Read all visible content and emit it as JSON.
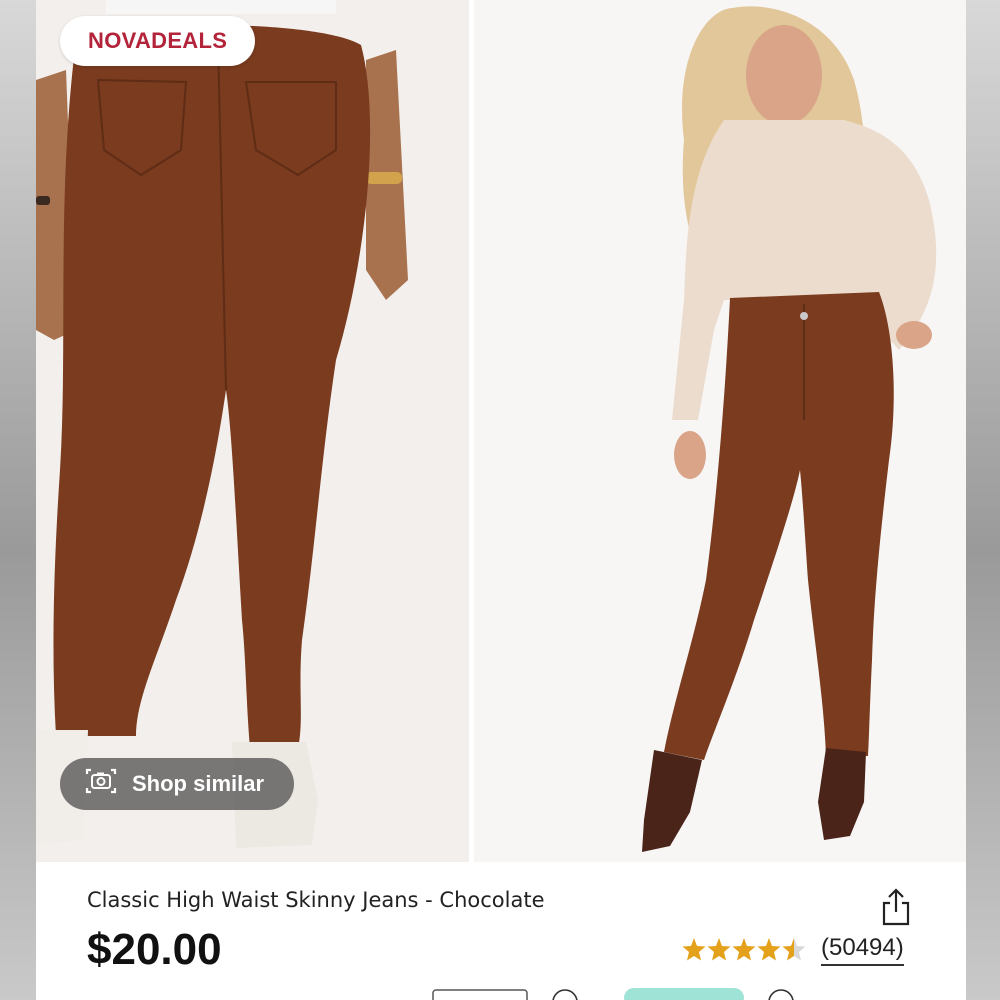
{
  "brand": {
    "label": "NOVADEALS"
  },
  "shop_similar": {
    "label": "Shop similar",
    "icon": "camera-icon"
  },
  "product": {
    "title": "Classic High Waist Skinny Jeans - Chocolate",
    "price": "$20.00",
    "rating": 4.5,
    "reviews": "(50494)"
  },
  "colors": {
    "brand_red": "#b3243a",
    "star_gold": "#e4a11b",
    "pants_brown": "#7a3b1f",
    "accent_teal": "#9ee3d5"
  }
}
